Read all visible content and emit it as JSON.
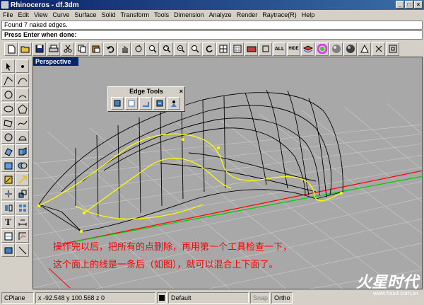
{
  "window": {
    "title": "Rhinoceros - df.3dm",
    "min_icon": "minimize-icon",
    "max_icon": "maximize-icon",
    "close_icon": "close-icon"
  },
  "menu": [
    "File",
    "Edit",
    "View",
    "Curve",
    "Surface",
    "Solid",
    "Transform",
    "Tools",
    "Dimension",
    "Analyze",
    "Render",
    "Raytrace(R)",
    "Help"
  ],
  "command": {
    "history": "Found 7 naked edges.",
    "prompt": "Press Enter when done:"
  },
  "toolbar": {
    "icons": [
      "new-icon",
      "open-icon",
      "save-icon",
      "print-icon",
      "cut-icon",
      "copy-icon",
      "paste-icon",
      "undo-icon",
      "pan-icon",
      "rotate-view-icon",
      "zoom-icon",
      "zoom-window-icon",
      "zoom-extents-icon",
      "zoom-selected-icon",
      "undo-view-icon",
      "four-viewports-icon",
      "grid-icon",
      "camera-icon",
      "select-all-icon",
      "show-all-icon",
      "hide-icon",
      "layer-icon",
      "color-wheel-icon",
      "sphere-icon",
      "render-icon",
      "light-icon",
      "options-icon",
      "help-icon"
    ],
    "all_label": "ALL",
    "hide_label": "HIDE"
  },
  "sidebar": {
    "icons": [
      "select-icon",
      "point-icon",
      "polyline-icon",
      "curve-icon",
      "circle-icon",
      "arc-icon",
      "ellipse-icon",
      "polygon-icon",
      "rectangle-icon",
      "free-curve-icon",
      "solid-box-icon",
      "sphere-solid-icon",
      "surface-icon",
      "extrude-icon",
      "fillet-icon",
      "boolean-icon",
      "mesh-icon",
      "move-icon",
      "rotate-icon",
      "scale-icon",
      "mirror-icon",
      "array-icon",
      "text-icon",
      "dimension-icon",
      "transform-icon",
      "analyze-icon",
      "render-object-icon",
      "camera-target-icon"
    ],
    "text_tool": "T"
  },
  "viewport": {
    "label": "Perspective"
  },
  "edge_tools": {
    "title": "Edge Tools",
    "close": "×",
    "buttons": [
      "show-edges-icon",
      "split-edge-icon",
      "merge-edge-icon",
      "join-edge-icon",
      "rebuild-edges-icon"
    ]
  },
  "annotation": {
    "line1": "操作完以后，把所有的点删除，再用第一个工具检查一下，",
    "line2": "这个面上的线是一条后（如图），就可以混合上下面了。"
  },
  "status": {
    "cplane": "CPlane",
    "coords": "x -92.548  y 100.568  z 0",
    "layer": "Default",
    "snap": "Snap",
    "ortho": "Ortho",
    "layer_color": "#000000"
  },
  "watermark": {
    "text": "火星时代",
    "url": "www.hxsd.com.cn"
  },
  "colors": {
    "title_start": "#0a246a",
    "title_end": "#3a6ea5",
    "annotation": "#ff0000",
    "selected_edges": "#ffff00",
    "x_axis": "#ff0000",
    "y_axis": "#00cc00"
  }
}
